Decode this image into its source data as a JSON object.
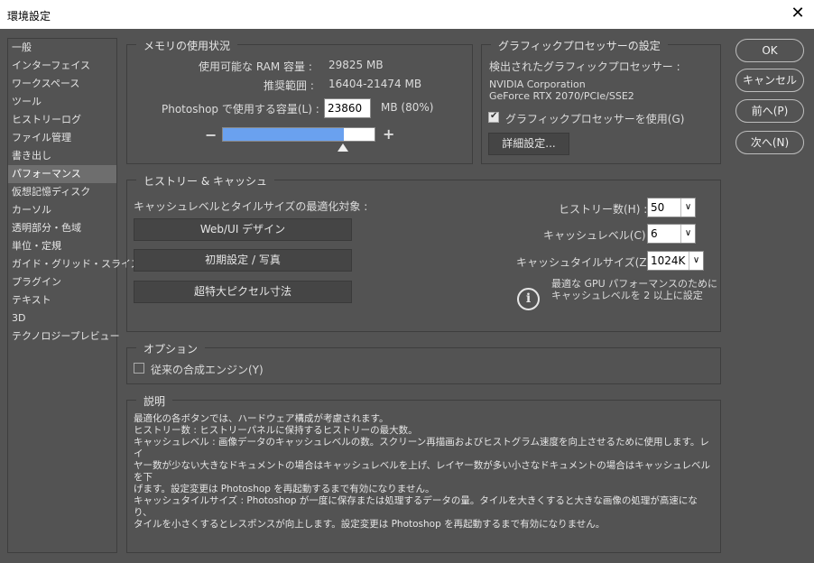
{
  "window": {
    "title": "環境設定",
    "close_glyph": "✕"
  },
  "sidebar": {
    "items": [
      {
        "label": "一般"
      },
      {
        "label": "インターフェイス"
      },
      {
        "label": "ワークスペース"
      },
      {
        "label": "ツール"
      },
      {
        "label": "ヒストリーログ"
      },
      {
        "label": "ファイル管理"
      },
      {
        "label": "書き出し"
      },
      {
        "label": "パフォーマンス",
        "active": true
      },
      {
        "label": "仮想記憶ディスク"
      },
      {
        "label": "カーソル"
      },
      {
        "label": "透明部分・色域"
      },
      {
        "label": "単位・定規"
      },
      {
        "label": "ガイド・グリッド・スライス"
      },
      {
        "label": "プラグイン"
      },
      {
        "label": "テキスト"
      },
      {
        "label": "3D"
      },
      {
        "label": "テクノロジープレビュー"
      }
    ]
  },
  "memory": {
    "title": "メモリの使用状況",
    "available_label": "使用可能な RAM 容量 :",
    "available_value": "29825 MB",
    "recommended_label": "推奨範囲 :",
    "recommended_value": "16404-21474 MB",
    "usage_label": "Photoshop で使用する容量(L) :",
    "usage_value": "23860",
    "usage_unit": "MB (80%)",
    "slider_minus": "−",
    "slider_plus": "+",
    "slider_fraction": 0.8
  },
  "gpu": {
    "title": "グラフィックプロセッサーの設定",
    "detected_label": "検出されたグラフィックプロセッサー :",
    "vendor": "NVIDIA Corporation",
    "model": "GeForce RTX 2070/PCIe/SSE2",
    "use_gpu_label": "グラフィックプロセッサーを使用(G)",
    "use_gpu_checked": true,
    "advanced_button": "詳細設定..."
  },
  "history_cache": {
    "title": "ヒストリー & キャッシュ",
    "optimize_label": "キャッシュレベルとタイルサイズの最適化対象 :",
    "buttons": [
      "Web/UI デザイン",
      "初期設定 / 写真",
      "超特大ピクセル寸法"
    ],
    "history_label": "ヒストリー数(H) :",
    "history_value": "50",
    "cache_level_label": "キャッシュレベル(C) :",
    "cache_level_value": "6",
    "tile_size_label": "キャッシュタイルサイズ(Z) :",
    "tile_size_value": "1024K",
    "info_line1": "最適な GPU パフォーマンスのために",
    "info_line2": "キャッシュレベルを 2 以上に設定"
  },
  "options": {
    "title": "オプション",
    "legacy_engine_label": "従来の合成エンジン(Y)",
    "legacy_engine_checked": false
  },
  "description": {
    "title": "説明",
    "lines": [
      "最適化の各ボタンでは、ハードウェア構成が考慮されます。",
      "ヒストリー数 : ヒストリーパネルに保持するヒストリーの最大数。",
      "キャッシュレベル : 画像データのキャッシュレベルの数。スクリーン再描画およびヒストグラム速度を向上させるために使用します。レイ",
      "ヤー数が少ない大きなドキュメントの場合はキャッシュレベルを上げ、レイヤー数が多い小さなドキュメントの場合はキャッシュレベルを下",
      "げます。設定変更は Photoshop を再起動するまで有効になりません。",
      "キャッシュタイルサイズ : Photoshop が一度に保存または処理するデータの量。タイルを大きくすると大きな画像の処理が高速になり、",
      "タイルを小さくするとレスポンスが向上します。設定変更は Photoshop を再起動するまで有効になりません。"
    ]
  },
  "actions": {
    "ok": "OK",
    "cancel": "キャンセル",
    "prev": "前へ(P)",
    "next": "次へ(N)"
  },
  "colors": {
    "panel_bg": "#535353",
    "slider_fill": "#6aa1ef",
    "border": "#3e3e3e"
  }
}
